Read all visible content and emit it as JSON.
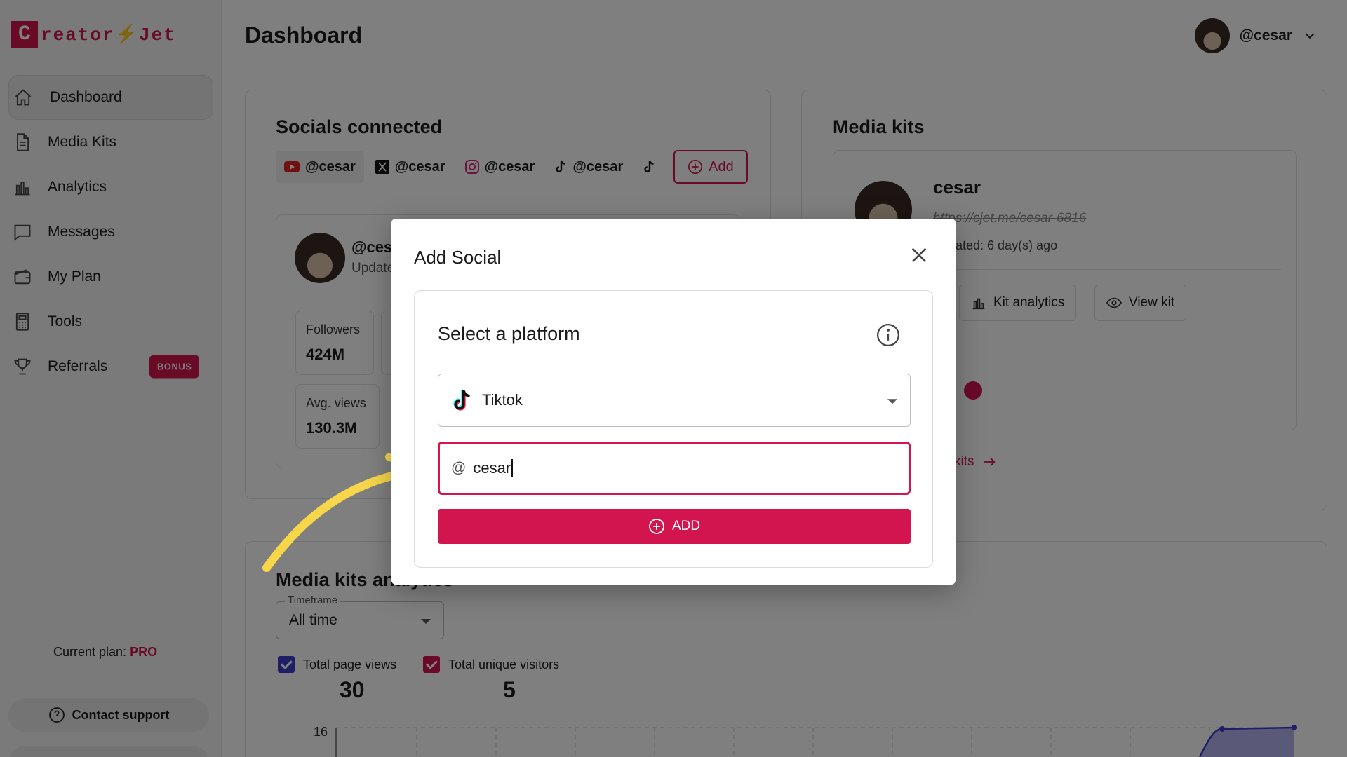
{
  "brand": {
    "logo_letter": "C",
    "logo_text": "reator⚡Jet",
    "accent": "#d3154f"
  },
  "sidebar": {
    "items": [
      {
        "label": "Dashboard",
        "icon": "home-icon",
        "active": true
      },
      {
        "label": "Media Kits",
        "icon": "document-icon"
      },
      {
        "label": "Analytics",
        "icon": "bar-chart-icon"
      },
      {
        "label": "Messages",
        "icon": "message-icon"
      },
      {
        "label": "My Plan",
        "icon": "wallet-icon"
      },
      {
        "label": "Tools",
        "icon": "calculator-icon"
      },
      {
        "label": "Referrals",
        "icon": "trophy-icon",
        "badge": "BONUS"
      }
    ],
    "plan_label": "Current plan:",
    "plan_value": "PRO",
    "contact_label": "Contact support"
  },
  "header": {
    "title": "Dashboard",
    "username": "@cesar"
  },
  "socials": {
    "title": "Socials connected",
    "chips": [
      {
        "platform": "youtube",
        "handle": "@cesar"
      },
      {
        "platform": "x",
        "handle": "@cesar"
      },
      {
        "platform": "instagram",
        "handle": "@cesar"
      },
      {
        "platform": "tiktok",
        "handle": "@cesar"
      }
    ],
    "add_label": "Add",
    "profile_handle": "@ces",
    "profile_sub": "Update",
    "stats": [
      {
        "label": "Followers",
        "value": "424M"
      },
      {
        "label": "Avg. views",
        "value": "130.3M"
      }
    ]
  },
  "media_kits": {
    "title": "Media kits",
    "kit_name": "cesar",
    "kit_url": "https://cjet.me/cesar-6816",
    "kit_updated": "lated: 6 day(s) ago",
    "analytics_label": "Kit analytics",
    "view_label": "View kit",
    "all_link": "kits"
  },
  "analytics": {
    "title": "Media kits analytics",
    "timeframe_label": "Timeframe",
    "timeframe_value": "All time",
    "legend": [
      {
        "label": "Total page views",
        "value": "30",
        "color": "#3f3fd1"
      },
      {
        "label": "Total unique visitors",
        "value": "5",
        "color": "#d3154f"
      }
    ],
    "y_top_tick": "16"
  },
  "modal": {
    "title": "Add Social",
    "panel_title": "Select a platform",
    "platform_value": "Tiktok",
    "handle_prefix": "@",
    "handle_value": "cesar",
    "submit_label": "ADD"
  }
}
